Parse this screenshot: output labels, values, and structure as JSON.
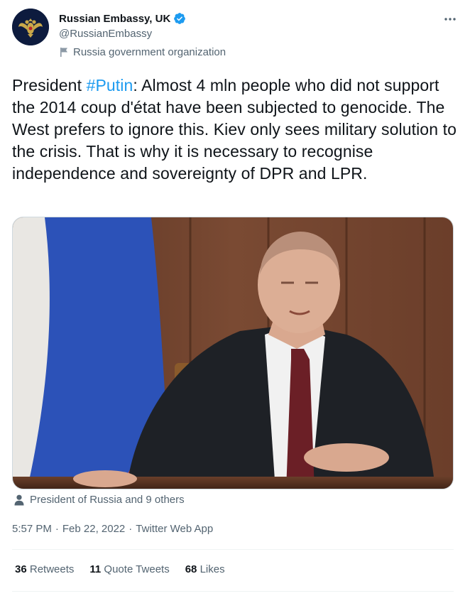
{
  "author": {
    "display_name": "Russian Embassy, UK",
    "handle": "@RussianEmbassy",
    "label": "Russia government organization"
  },
  "tweet": {
    "text_before": "President ",
    "hashtag": "#Putin",
    "text_after": ": Almost 4 mln people who did not support the 2014 coup d'état have been subjected to genocide. The West prefers to ignore this. Kiev only sees military solution to the crisis. That is why it is necessary to recognise independence and sovereignty of DPR and LPR.",
    "tagged": "President of Russia and 9 others",
    "time": "5:57 PM",
    "date": "Feb 22, 2022",
    "source": "Twitter Web App"
  },
  "stats": {
    "retweets_count": "36",
    "retweets_label": "Retweets",
    "quotes_count": "11",
    "quotes_label": "Quote Tweets",
    "likes_count": "68",
    "likes_label": "Likes"
  },
  "colors": {
    "accent": "#1d9bf0",
    "secondary_text": "#536471"
  },
  "icons": [
    "verified-badge-icon",
    "more-options-icon",
    "flag-icon",
    "person-icon"
  ]
}
